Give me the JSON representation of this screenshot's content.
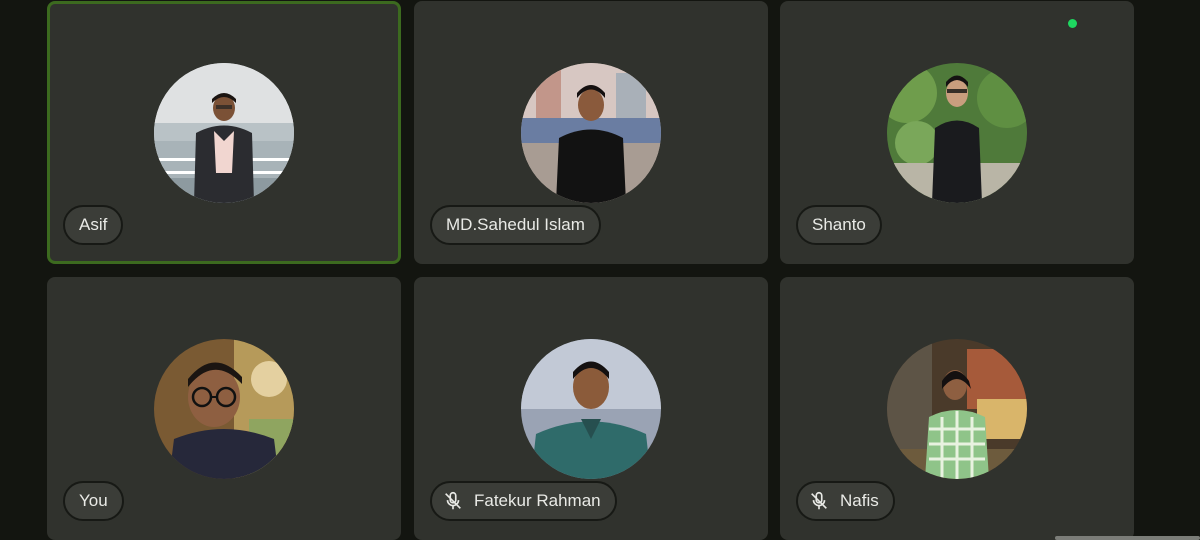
{
  "participants": [
    {
      "name": "Asif",
      "muted": false,
      "speaking": true
    },
    {
      "name": "MD.Sahedul Islam",
      "muted": false,
      "speaking": false
    },
    {
      "name": "Shanto",
      "muted": false,
      "speaking": false
    },
    {
      "name": "You",
      "muted": false,
      "speaking": false
    },
    {
      "name": "Fatekur Rahman",
      "muted": true,
      "speaking": false
    },
    {
      "name": "Nafis",
      "muted": true,
      "speaking": false
    }
  ],
  "colors": {
    "background": "#131510",
    "tile": "#30322d",
    "speaking_border": "#3c6a1f",
    "active_indicator": "#1ed760"
  },
  "icons": {
    "muted": "mic-off-icon"
  }
}
